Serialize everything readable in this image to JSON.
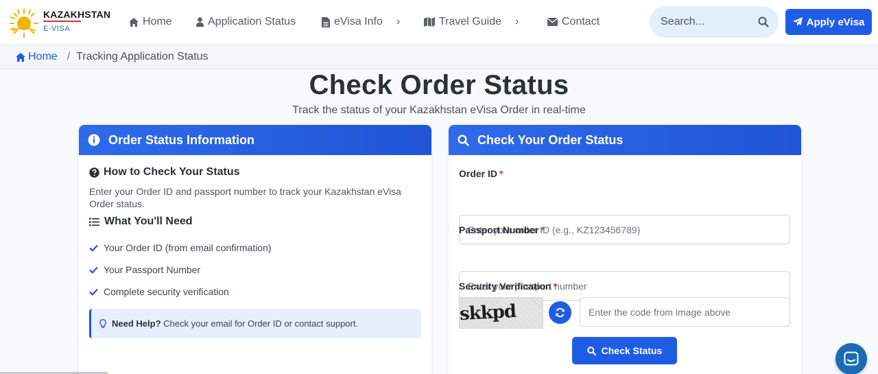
{
  "brand": {
    "name": "KAZAKHSTAN",
    "sub": "E-VISA"
  },
  "nav": {
    "home": "Home",
    "status": "Application Status",
    "evisa_info": "eVisa Info",
    "travel_guide": "Travel Guide",
    "contact": "Contact",
    "chevron": "›"
  },
  "search": {
    "placeholder": "Search..."
  },
  "apply_button": "Apply eVisa",
  "breadcrumb": {
    "home": "Home",
    "separator": "/",
    "current": "Tracking Application Status"
  },
  "hero": {
    "title": "Check Order Status",
    "subtitle": "Track the status of your Kazakhstan eVisa Order in real-time"
  },
  "info_card": {
    "header": "Order Status Information",
    "how_title": "How to Check Your Status",
    "how_desc": "Enter your Order ID and passport number to track your Kazakhstan eVisa Order status.",
    "need_title": "What You'll Need",
    "needs": [
      "Your Order ID (from email confirmation)",
      "Your Passport Number",
      "Complete security verification"
    ],
    "help_label": "Need Help?",
    "help_text": "Check your email for Order ID or contact support."
  },
  "form_card": {
    "header": "Check Your Order Status",
    "order_id_label": "Order ID",
    "order_id_placeholder": "Enter your order ID (e.g., KZ123456789)",
    "passport_label": "Passport Number",
    "passport_placeholder": "Enter your passport number",
    "security_label": "Security Verification",
    "captcha_text": "skkpd",
    "captcha_placeholder": "Enter the code from image above",
    "required_mark": "*",
    "submit": "Check Status"
  },
  "colors": {
    "primary": "#1f5ce6",
    "header_gradient_start": "#2e6bea",
    "required": "#dc3545",
    "chat": "#1c6bb5"
  }
}
